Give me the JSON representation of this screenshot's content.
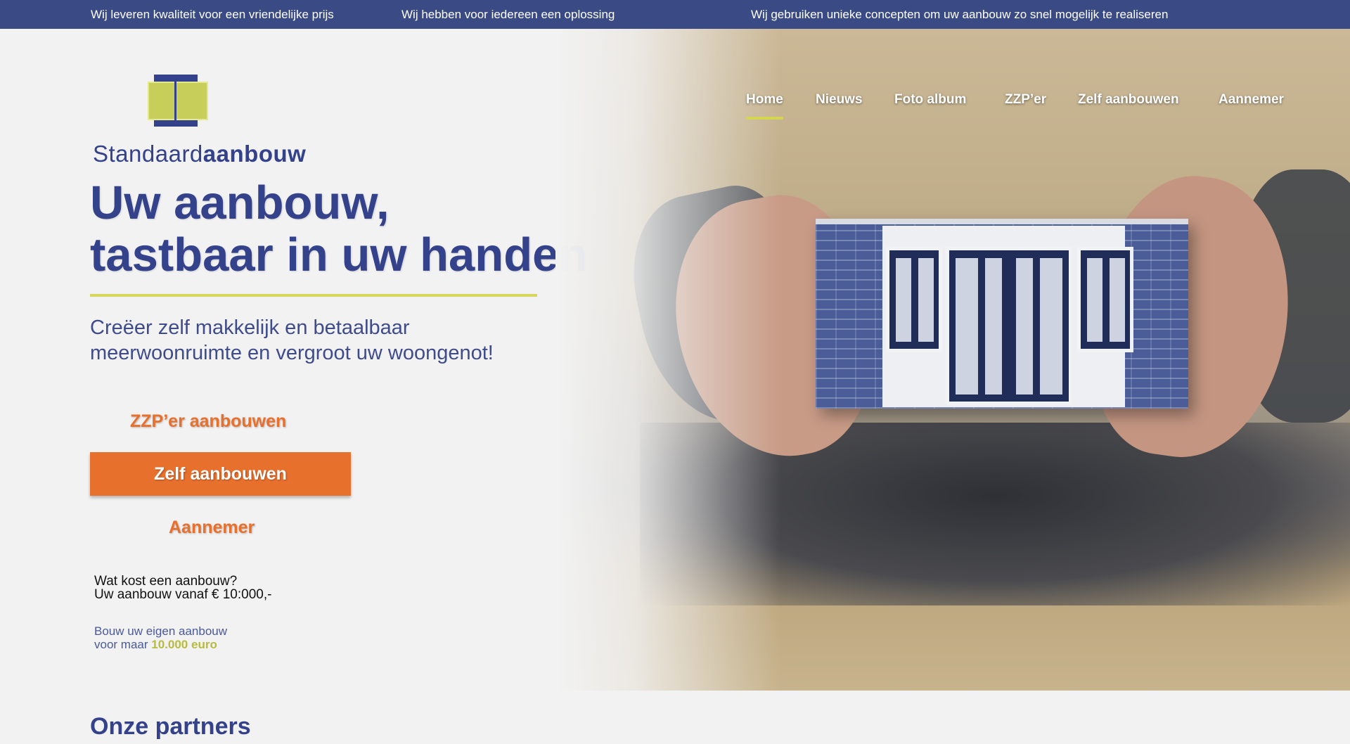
{
  "topbar": {
    "items": [
      "Wij leveren kwaliteit voor een vriendelijke prijs",
      "Wij hebben voor iedereen een oplossing",
      "Wij gebruiken unieke concepten om uw aanbouw zo snel mogelijk te realiseren"
    ]
  },
  "logo": {
    "word_light": "Standaard",
    "word_bold": "aanbouw"
  },
  "nav": {
    "items": [
      "Home",
      "Nieuws",
      "Foto album",
      "ZZP’er",
      "Zelf aanbouwen",
      "Aannemer"
    ],
    "active": "Home"
  },
  "hero": {
    "headline_line1": "Uw aanbouw,",
    "headline_line2": "tastbaar in uw handen",
    "subtitle_line1": "Creëer zelf makkelijk en betaalbaar",
    "subtitle_line2": "meerwoonruimte en vergroot uw woongenot!"
  },
  "cta": {
    "zzp": "ZZP’er aanbouwen",
    "zelf": "Zelf aanbouwen",
    "aannemer": "Aannemer"
  },
  "price": {
    "question": "Wat kost een aanbouw?",
    "from": "Uw aanbouw vanaf € 10:000,-"
  },
  "promo": {
    "line1": "Bouw uw eigen aanbouw",
    "line2_prefix": "voor maar",
    "amount": "10.000 euro"
  },
  "partners": {
    "title": "Onze partners"
  },
  "colors": {
    "brand_blue": "#34428c",
    "topbar": "#3a4a85",
    "accent_orange": "#e8702d",
    "accent_yellow": "#d8d65a"
  }
}
